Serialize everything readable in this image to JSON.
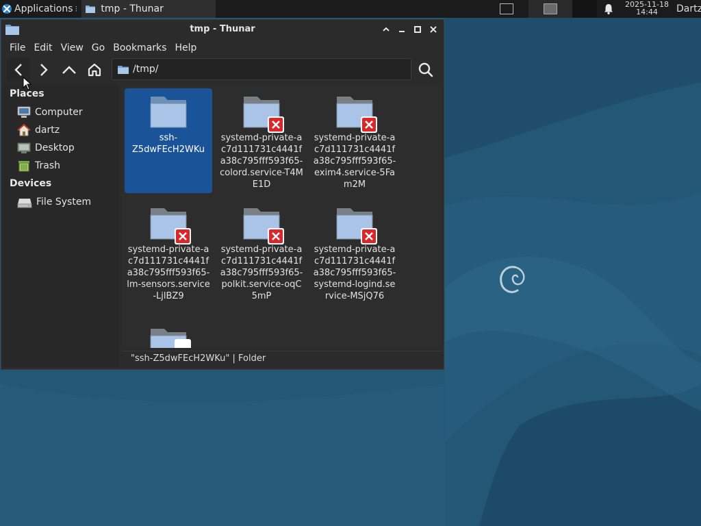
{
  "panel": {
    "applications_label": "Applications",
    "task_label": "tmp - Thunar",
    "clock_date": "2025-11-18",
    "clock_time": "14:44",
    "user": "Dartz"
  },
  "window": {
    "title": "tmp - Thunar",
    "menu": [
      "File",
      "Edit",
      "View",
      "Go",
      "Bookmarks",
      "Help"
    ],
    "location_path": "/tmp/"
  },
  "sidebar": {
    "places_heading": "Places",
    "places": [
      {
        "label": "Computer",
        "icon": "computer-icon"
      },
      {
        "label": "dartz",
        "icon": "home-icon"
      },
      {
        "label": "Desktop",
        "icon": "desktop-icon"
      },
      {
        "label": "Trash",
        "icon": "trash-icon"
      }
    ],
    "devices_heading": "Devices",
    "devices": [
      {
        "label": "File System",
        "icon": "drive-icon"
      }
    ]
  },
  "files": [
    {
      "name": "ssh-Z5dwFEcH2WKu",
      "locked": false,
      "selected": true
    },
    {
      "name": "systemd-private-ac7d111731c4441fa38c795fff593f65-colord.service-T4ME1D",
      "locked": true
    },
    {
      "name": "systemd-private-ac7d111731c4441fa38c795fff593f65-exim4.service-5Fam2M",
      "locked": true
    },
    {
      "name": "systemd-private-ac7d111731c4441fa38c795fff593f65-lm-sensors.service-LjlBZ9",
      "locked": true
    },
    {
      "name": "systemd-private-ac7d111731c4441fa38c795fff593f65-polkit.service-oqC5mP",
      "locked": true
    },
    {
      "name": "systemd-private-ac7d111731c4441fa38c795fff593f65-systemd-logind.service-MSjQ76",
      "locked": true
    }
  ],
  "file_labels": [
    "ssh-\nZ5dwFEcH2WKu",
    "systemd-private-ac7d111731c4441fa38c795fff593f65-colord.service-T4ME1D",
    "systemd-private-ac7d111731c4441fa38c795fff593f65-exim4.service-5Fam2M",
    "systemd-private-ac7d111731c4441fa38c795fff593f65-lm-sensors.service-LjlBZ9",
    "systemd-private-ac7d111731c4441fa38c795fff593f65-polkit.service-oqC5mP",
    "systemd-private-ac7d111731c4441fa38c795fff593f65-systemd-logind.service-MSjQ76"
  ],
  "status": "\"ssh-Z5dwFEcH2WKu\"  |  Folder",
  "colors": {
    "selection": "#1b5399",
    "desktop": "#245675",
    "lock_badge": "#d9262b"
  }
}
